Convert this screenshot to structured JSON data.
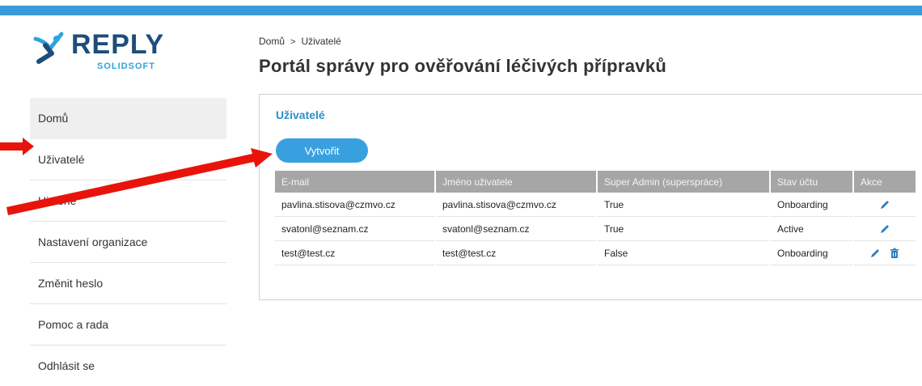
{
  "brand": {
    "logo_word": "REPLY",
    "logo_sub": "SOLIDSOFT",
    "topbar_color": "#3a9ad9",
    "accent_color": "#2a8fd0"
  },
  "sidebar": {
    "items": [
      {
        "label": "Domů",
        "active": true
      },
      {
        "label": "Uživatelé",
        "active": false
      },
      {
        "label": "Historie",
        "active": false
      },
      {
        "label": "Nastavení organizace",
        "active": false
      },
      {
        "label": "Změnit heslo",
        "active": false
      },
      {
        "label": "Pomoc a rada",
        "active": false
      },
      {
        "label": "Odhlásit se",
        "active": false
      }
    ]
  },
  "breadcrumb": {
    "home": "Domů",
    "separator": ">",
    "current": "Uživatelé"
  },
  "page_title": "Portál správy pro ověřování léčivých přípravků",
  "panel": {
    "title": "Uživatelé",
    "create_label": "Vytvořit"
  },
  "table": {
    "headers": {
      "email": "E-mail",
      "username": "Jméno uživatele",
      "super_admin": "Super Admin (superspráce)",
      "status": "Stav účtu",
      "actions": "Akce"
    },
    "rows": [
      {
        "email": "pavlina.stisova@czmvo.cz",
        "username": "pavlina.stisova@czmvo.cz",
        "super_admin": "True",
        "status": "Onboarding",
        "icons": [
          "edit-icon"
        ]
      },
      {
        "email": "svatonl@seznam.cz",
        "username": "svatonl@seznam.cz",
        "super_admin": "True",
        "status": "Active",
        "icons": [
          "edit-icon"
        ]
      },
      {
        "email": "test@test.cz",
        "username": "test@test.cz",
        "super_admin": "False",
        "status": "Onboarding",
        "icons": [
          "edit-icon",
          "trash-icon"
        ]
      }
    ]
  },
  "annotations": {
    "arrow_color": "#e8140c"
  }
}
